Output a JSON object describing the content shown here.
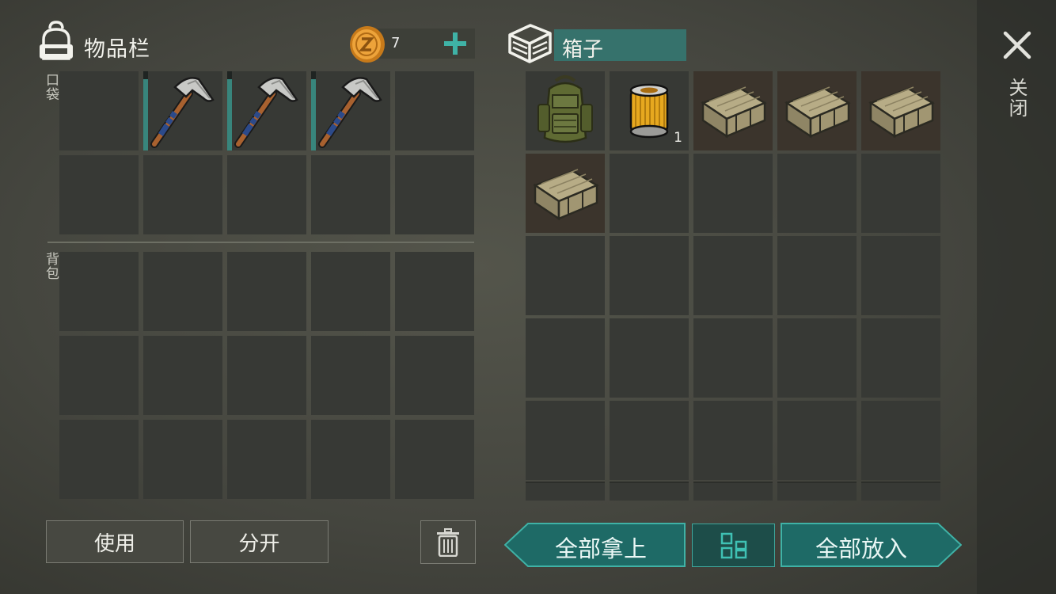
{
  "inventory": {
    "title": "物品栏",
    "coins": "7",
    "pocket_label": "口袋",
    "backpack_label": "背包"
  },
  "container": {
    "title": "箱子",
    "items": [
      {
        "name": "backpack",
        "qty": ""
      },
      {
        "name": "air filter",
        "qty": "1"
      },
      {
        "name": "wooden crate",
        "qty": ""
      },
      {
        "name": "wooden crate",
        "qty": ""
      },
      {
        "name": "wooden crate",
        "qty": ""
      },
      {
        "name": "wooden crate",
        "qty": ""
      }
    ]
  },
  "pocket_items": [
    "pickaxe",
    "pickaxe",
    "pickaxe"
  ],
  "close_label": "关闭",
  "buttons": {
    "use": "使用",
    "split": "分开",
    "take_all": "全部拿上",
    "put_all": "全部放入"
  },
  "icons": [
    "backpack-icon",
    "coin-icon",
    "plus-icon",
    "box-icon",
    "close-icon",
    "trash-icon",
    "grid-icon"
  ],
  "colors": {
    "accent": "#36726c",
    "teal_button": "#1e6a66",
    "panel": "#373935"
  }
}
